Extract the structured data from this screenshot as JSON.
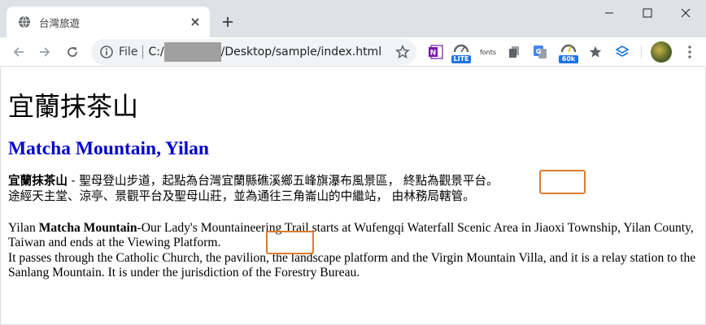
{
  "browser": {
    "tab_title": "台灣旅遊",
    "url_scheme": "File",
    "url_prefix": "C:/",
    "url_suffix": "/Desktop/sample/index.html",
    "extensions": {
      "onenote_label": "N",
      "lite_badge": "LITE",
      "fonts_label": "fonts",
      "count_badge": "60k"
    }
  },
  "page": {
    "h1": "宜蘭抹茶山",
    "h2": "Matcha Mountain, Yilan",
    "p1_bold": "宜蘭抹茶山",
    "p1_line1": " - 聖母登山步道，起點為台灣宜蘭縣礁溪鄉五峰旗瀑布風景區， 終點為觀景平台。",
    "p1_line2": "途經天主堂、涼亭、景觀平台及聖母山莊，並為通往三角崙山的中繼站， 由林務局轄管。",
    "p2_pre": "Yilan ",
    "p2_bold": "Matcha Mountain",
    "p2_line1": "-Our Lady's Mountaineering Trail starts at Wufengqi Waterfall Scenic Area in Jiaoxi Township, Yilan County, Taiwan and ends at the Viewing Platform.",
    "p2_line2": "It passes through the Catholic Church, the pavilion, the landscape platform and the Virgin Mountain Villa, and it is a relay station to the Sanlang Mountain. It is under the jurisdiction of the Forestry Bureau."
  },
  "colors": {
    "heading2": "#0000cd",
    "highlight_box": "#e07b2f",
    "tabstrip": "#dee1e6"
  }
}
